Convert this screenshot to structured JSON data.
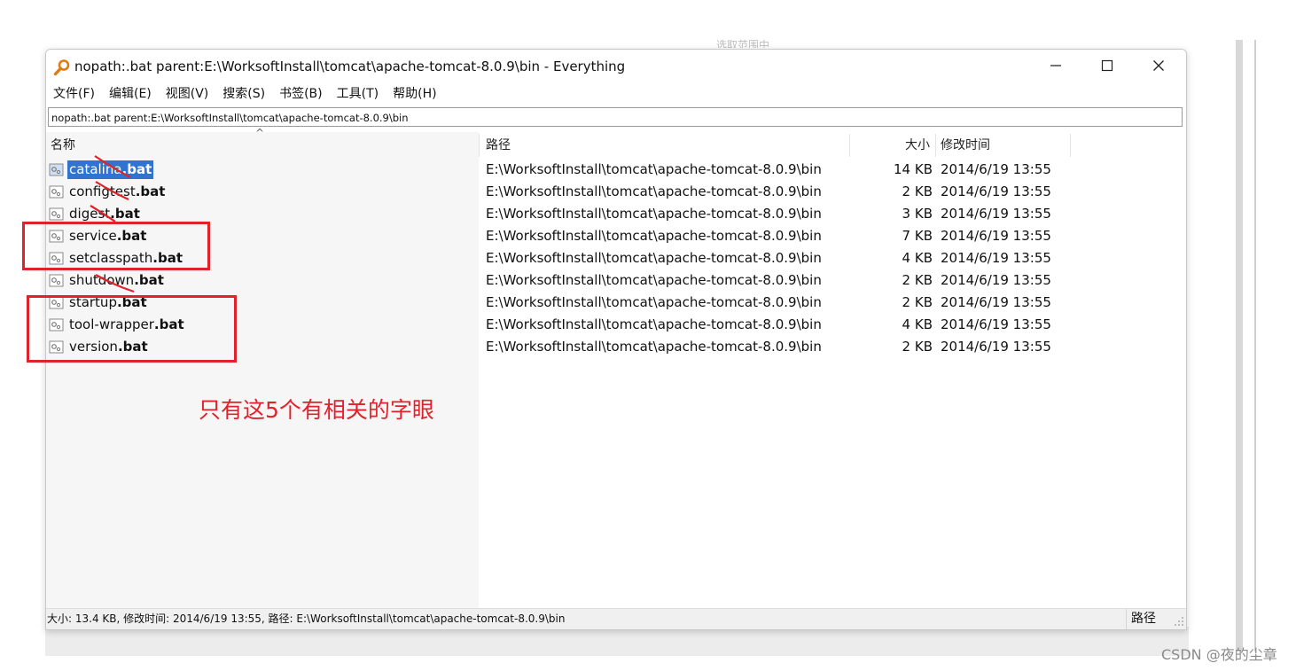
{
  "window": {
    "title": "nopath:.bat parent:E:\\WorksoftInstall\\tomcat\\apache-tomcat-8.0.9\\bin  - Everything",
    "minimize_icon": "minimize-icon",
    "maximize_icon": "maximize-icon",
    "close_icon": "close-icon"
  },
  "menu": {
    "items": [
      "文件(F)",
      "编辑(E)",
      "视图(V)",
      "搜索(S)",
      "书签(B)",
      "工具(T)",
      "帮助(H)"
    ]
  },
  "search": {
    "value": "nopath:.bat parent:E:\\WorksoftInstall\\tomcat\\apache-tomcat-8.0.9\\bin"
  },
  "columns": {
    "name": "名称",
    "path": "路径",
    "size": "大小",
    "modified": "修改时间"
  },
  "files": [
    {
      "stem": "catalina",
      "ext": ".bat",
      "path": "E:\\WorksoftInstall\\tomcat\\apache-tomcat-8.0.9\\bin",
      "size": "14 KB",
      "modified": "2014/6/19 13:55",
      "selected": true
    },
    {
      "stem": "configtest",
      "ext": ".bat",
      "path": "E:\\WorksoftInstall\\tomcat\\apache-tomcat-8.0.9\\bin",
      "size": "2 KB",
      "modified": "2014/6/19 13:55",
      "selected": false
    },
    {
      "stem": "digest",
      "ext": ".bat",
      "path": "E:\\WorksoftInstall\\tomcat\\apache-tomcat-8.0.9\\bin",
      "size": "3 KB",
      "modified": "2014/6/19 13:55",
      "selected": false
    },
    {
      "stem": "service",
      "ext": ".bat",
      "path": "E:\\WorksoftInstall\\tomcat\\apache-tomcat-8.0.9\\bin",
      "size": "7 KB",
      "modified": "2014/6/19 13:55",
      "selected": false
    },
    {
      "stem": "setclasspath",
      "ext": ".bat",
      "path": "E:\\WorksoftInstall\\tomcat\\apache-tomcat-8.0.9\\bin",
      "size": "4 KB",
      "modified": "2014/6/19 13:55",
      "selected": false
    },
    {
      "stem": "shutdown",
      "ext": ".bat",
      "path": "E:\\WorksoftInstall\\tomcat\\apache-tomcat-8.0.9\\bin",
      "size": "2 KB",
      "modified": "2014/6/19 13:55",
      "selected": false
    },
    {
      "stem": "startup",
      "ext": ".bat",
      "path": "E:\\WorksoftInstall\\tomcat\\apache-tomcat-8.0.9\\bin",
      "size": "2 KB",
      "modified": "2014/6/19 13:55",
      "selected": false
    },
    {
      "stem": "tool-wrapper",
      "ext": ".bat",
      "path": "E:\\WorksoftInstall\\tomcat\\apache-tomcat-8.0.9\\bin",
      "size": "4 KB",
      "modified": "2014/6/19 13:55",
      "selected": false
    },
    {
      "stem": "version",
      "ext": ".bat",
      "path": "E:\\WorksoftInstall\\tomcat\\apache-tomcat-8.0.9\\bin",
      "size": "2 KB",
      "modified": "2014/6/19 13:55",
      "selected": false
    }
  ],
  "file_icon": "batch-file-icon",
  "statusbar": {
    "info": "大小: 13.4 KB, 修改时间: 2014/6/19 13:55, 路径: E:\\WorksoftInstall\\tomcat\\apache-tomcat-8.0.9\\bin",
    "right_label": "路径"
  },
  "annotation": {
    "text": "只有这5个有相关的字眼",
    "color": "#e0232a"
  },
  "background": {
    "ghost_text": "选取范围中"
  },
  "watermark": "CSDN @夜的尘章",
  "colors": {
    "selection": "#2f74d0",
    "annotation": "#e0232a"
  }
}
